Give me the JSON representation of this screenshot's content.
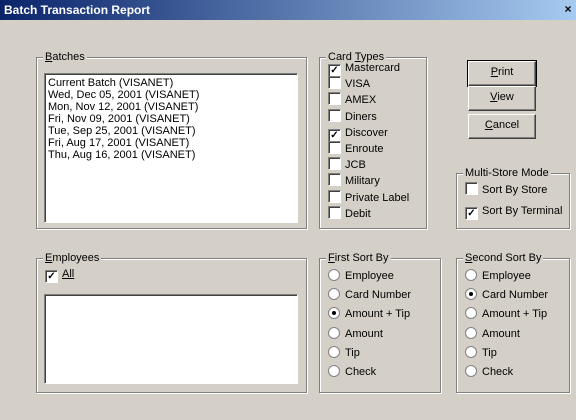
{
  "window": {
    "title": "Batch Transaction Report",
    "close_glyph": "×"
  },
  "batches": {
    "legend_first": "B",
    "legend_rest": "atches",
    "items": [
      "Current Batch (VISANET)",
      "Wed, Dec 05, 2001 (VISANET)",
      "Mon, Nov 12, 2001 (VISANET)",
      "Fri, Nov 09, 2001 (VISANET)",
      "Tue, Sep 25, 2001 (VISANET)",
      "Fri, Aug 17, 2001 (VISANET)",
      "Thu, Aug 16, 2001 (VISANET)"
    ]
  },
  "card_types": {
    "legend_pre": "Card ",
    "legend_ul": "T",
    "legend_post": "ypes",
    "items": [
      {
        "label": "Mastercard",
        "checked": true
      },
      {
        "label": "VISA",
        "checked": false
      },
      {
        "label": "AMEX",
        "checked": false
      },
      {
        "label": "Diners",
        "checked": false
      },
      {
        "label": "Discover",
        "checked": true
      },
      {
        "label": "Enroute",
        "checked": false
      },
      {
        "label": "JCB",
        "checked": false
      },
      {
        "label": "Military",
        "checked": false
      },
      {
        "label": "Private Label",
        "checked": false
      },
      {
        "label": "Debit",
        "checked": false
      }
    ]
  },
  "buttons": {
    "print_first": "P",
    "print_rest": "rint",
    "view_first": "V",
    "view_rest": "iew",
    "cancel_first": "C",
    "cancel_rest": "ancel"
  },
  "multi_store": {
    "legend": "Multi-Store Mode",
    "sort_by_store": {
      "label": "Sort By Store",
      "checked": false
    },
    "sort_by_terminal": {
      "label": "Sort By Terminal",
      "checked": true
    }
  },
  "employees": {
    "legend_first": "E",
    "legend_rest": "mployees",
    "all_label": "All",
    "all_checked": true
  },
  "first_sort": {
    "legend_first": "F",
    "legend_rest": "irst Sort By",
    "options": [
      "Employee",
      "Card Number",
      "Amount + Tip",
      "Amount",
      "Tip",
      "Check"
    ],
    "selected": "Amount + Tip"
  },
  "second_sort": {
    "legend_first": "S",
    "legend_rest": "econd Sort By",
    "options": [
      "Employee",
      "Card Number",
      "Amount + Tip",
      "Amount",
      "Tip",
      "Check"
    ],
    "selected": "Card Number"
  }
}
